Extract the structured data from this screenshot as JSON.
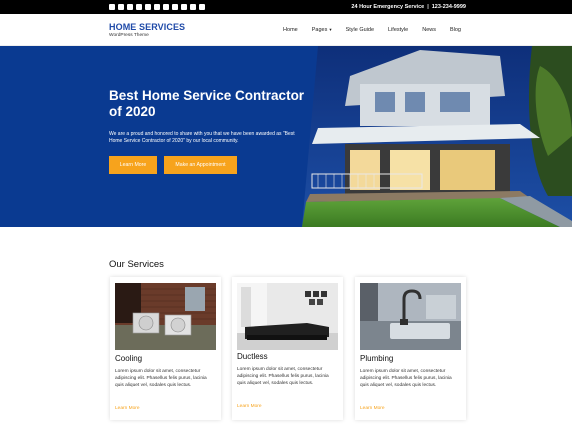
{
  "topbar": {
    "social_icons": [
      "facebook-icon",
      "twitter-icon",
      "instagram-icon",
      "linkedin-icon",
      "youtube-icon",
      "pinterest-icon",
      "github-icon",
      "xing-icon",
      "tumblr-icon",
      "chat-icon",
      "flickr-icon"
    ],
    "emergency_label": "24 Hour Emergency Service",
    "separator": "|",
    "phone": "123-234-9999"
  },
  "header": {
    "title": "HOME SERVICES",
    "tagline": "WordPress Theme",
    "nav": [
      {
        "label": "Home",
        "dropdown": false
      },
      {
        "label": "Pages",
        "dropdown": true
      },
      {
        "label": "Style Guide",
        "dropdown": false
      },
      {
        "label": "Lifestyle",
        "dropdown": false
      },
      {
        "label": "News",
        "dropdown": false
      },
      {
        "label": "Blog",
        "dropdown": false
      }
    ]
  },
  "hero": {
    "headline": "Best Home Service Contractor of 2020",
    "body": "We are a proud and honored to share with you that we have been awarded as \"Best Home Service Contractor of 2020\" by our local community.",
    "button_primary": "Learn More",
    "button_secondary": "Make an Appointment"
  },
  "services": {
    "heading": "Our Services",
    "cards": [
      {
        "title": "Cooling",
        "text": "Lorem ipsum dolor sit amet, consectetur adipiscing elit. Phasellus felis purus, lacinia quis aliquet vel, sodales quis lectus.",
        "link": "Learn More"
      },
      {
        "title": "Ductless",
        "text": "Lorem ipsum dolor sit amet, consectetur adipiscing elit. Phasellus felis purus, lacinia quis aliquet vel, sodales quis lectus.",
        "link": "Learn More"
      },
      {
        "title": "Plumbing",
        "text": "Lorem ipsum dolor sit amet, consectetur adipiscing elit. Phasellus felis purus, lacinia quis aliquet vel, sodales quis lectus.",
        "link": "Learn More"
      }
    ]
  },
  "colors": {
    "brand_blue": "#1f4aa8",
    "hero_blue": "#0a3a91",
    "accent_orange": "#f7a31c",
    "topbar_black": "#000000"
  }
}
